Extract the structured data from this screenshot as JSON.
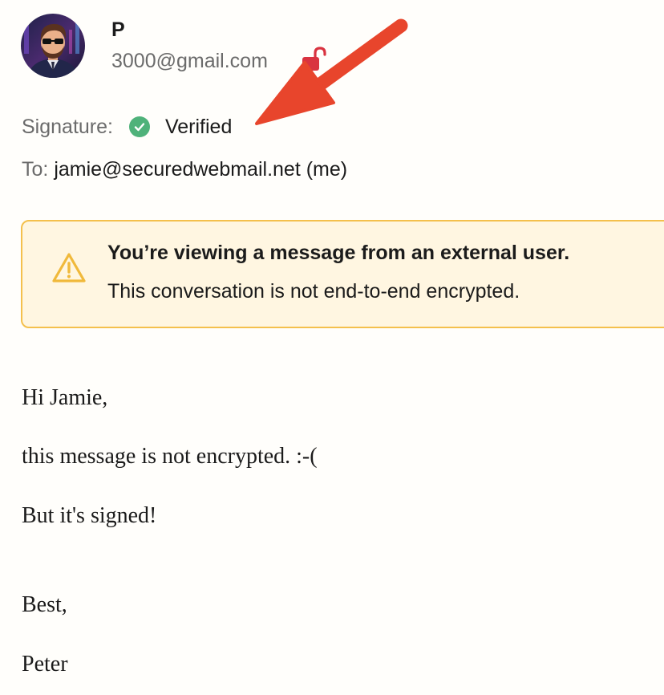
{
  "sender": {
    "name": "P",
    "email": "3000@gmail.com",
    "avatar": "avatar-icon",
    "lock_icon": "unlocked-padlock-icon"
  },
  "signature": {
    "label": "Signature:",
    "status_icon": "check-circle-icon",
    "status": "Verified"
  },
  "recipient": {
    "label": "To:",
    "value": "jamie@securedwebmail.net (me)"
  },
  "annotation": {
    "arrow_icon": "red-arrow-icon"
  },
  "banner": {
    "icon": "warning-icon",
    "title": "You’re viewing a message from an external user.",
    "text": "This conversation is not end-to-end encrypted."
  },
  "body": {
    "lines": [
      "Hi Jamie,",
      "this message is not encrypted. :-(",
      "But it's signed!",
      "Best,",
      "Peter"
    ]
  },
  "colors": {
    "background": "#fffefb",
    "lock": "#d93340",
    "verified": "#4fb27a",
    "arrow": "#e8452c",
    "banner_bg": "#fff6e1",
    "banner_border": "#f4c04d",
    "warning": "#f0b93b"
  }
}
